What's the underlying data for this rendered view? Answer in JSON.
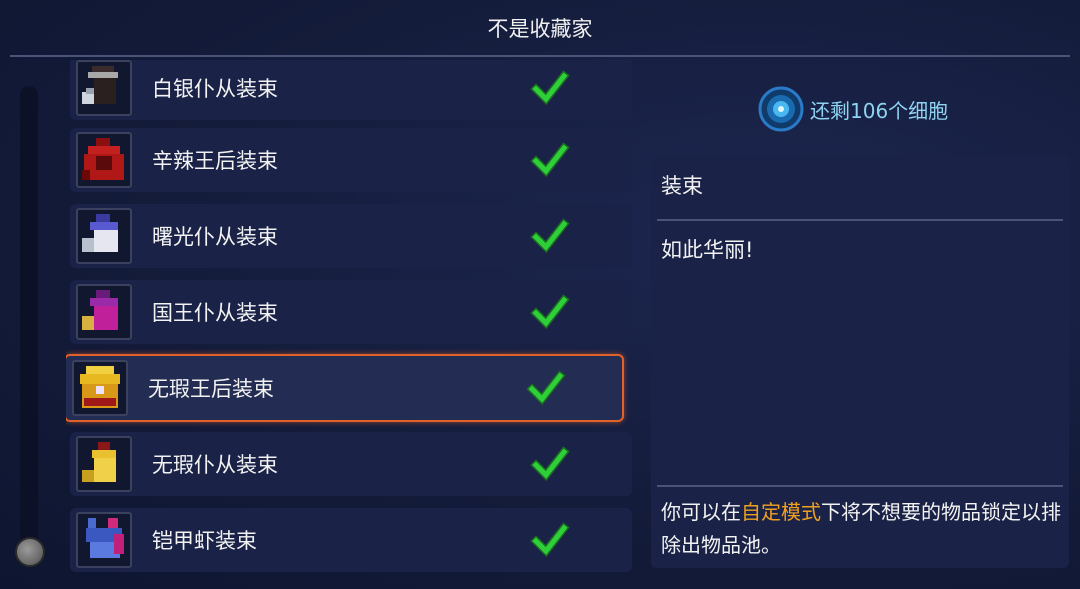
{
  "header": {
    "title": "不是收藏家"
  },
  "items": [
    {
      "name": "白银仆从装束",
      "icon": "silver-servant-outfit-icon",
      "unlocked": true
    },
    {
      "name": "辛辣王后装束",
      "icon": "spicy-queen-outfit-icon",
      "unlocked": true
    },
    {
      "name": "曙光仆从装束",
      "icon": "dawn-servant-outfit-icon",
      "unlocked": true
    },
    {
      "name": "国王仆从装束",
      "icon": "king-servant-outfit-icon",
      "unlocked": true
    },
    {
      "name": "无瑕王后装束",
      "icon": "flawless-queen-outfit-icon",
      "unlocked": true,
      "selected": true
    },
    {
      "name": "无瑕仆从装束",
      "icon": "flawless-servant-outfit-icon",
      "unlocked": true
    },
    {
      "name": "铠甲虾装束",
      "icon": "armored-shrimp-outfit-icon",
      "unlocked": true
    }
  ],
  "cells": {
    "text": "还剩106个细胞",
    "icon": "cell-icon"
  },
  "details": {
    "category": "装束",
    "description": "如此华丽!",
    "hint_prefix": "你可以在",
    "hint_highlight": "自定模式",
    "hint_suffix": "下将不想要的物品锁定以排除出物品池。"
  },
  "colors": {
    "accent_selected": "#e0622a",
    "check_green": "#2fcf3a",
    "cells_text": "#8fd3f2",
    "highlight": "#f0a020"
  }
}
